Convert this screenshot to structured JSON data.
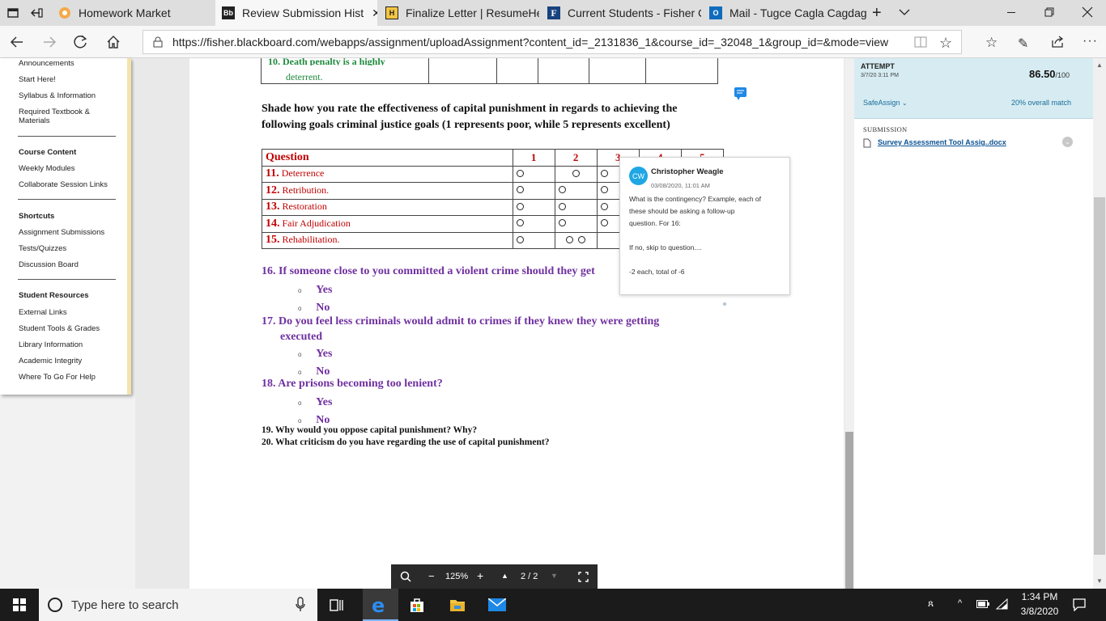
{
  "browser": {
    "tabs": [
      {
        "title": "Homework Market",
        "active": false
      },
      {
        "title": "Review Submission Hist",
        "active": true
      },
      {
        "title": "Finalize Letter | ResumeHelp",
        "active": false
      },
      {
        "title": "Current Students - Fisher Co",
        "active": false
      },
      {
        "title": "Mail - Tugce Cagla Cagdagu",
        "active": false
      }
    ],
    "url": "https://fisher.blackboard.com/webapps/assignment/uploadAssignment?content_id=_2131836_1&course_id=_32048_1&group_id=&mode=view"
  },
  "sidebar": {
    "top_items": [
      "Announcements",
      "Start Here!",
      "Syllabus & Information",
      "Required Textbook &",
      "Materials"
    ],
    "course_content": {
      "heading": "Course Content",
      "items": [
        "Weekly Modules",
        "Collaborate Session Links"
      ]
    },
    "shortcuts": {
      "heading": "Shortcuts",
      "items": [
        "Assignment Submissions",
        "Tests/Quizzes",
        "Discussion Board"
      ]
    },
    "student_resources": {
      "heading": "Student Resources",
      "items": [
        "External Links",
        "Student Tools & Grades",
        "Library Information",
        "Academic Integrity",
        "Where To Go For Help"
      ]
    }
  },
  "document": {
    "prev_row_line1": "10. Death penalty is a highly",
    "prev_row_line2": "deterrent.",
    "instruction_line1": "Shade how you rate the effectiveness of capital punishment in regards to achieving the",
    "instruction_line2": "following goals criminal justice goals (1 represents poor, while 5 represents excellent)",
    "table": {
      "header": [
        "Question",
        "1",
        "2",
        "3",
        "4",
        "5"
      ],
      "rows": [
        {
          "num": "11.",
          "label": "Deterrence"
        },
        {
          "num": "12.",
          "label": "Retribution."
        },
        {
          "num": "13.",
          "label": "Restoration"
        },
        {
          "num": "14.",
          "label": "Fair Adjudication"
        },
        {
          "num": "15.",
          "label": "Rehabilitation."
        }
      ]
    },
    "q16": "16. If someone close to you committed a violent crime should they get",
    "q17_line1": "17. Do you feel less criminals would admit to crimes if they knew they were getting",
    "q17_line2": "executed",
    "q18": "18. Are prisons becoming too lenient?",
    "yes": "Yes",
    "no": "No",
    "q19": "19.  Why would you oppose capital punishment? Why?",
    "q20": "20.  What criticism do you have regarding the use of capital punishment?"
  },
  "comment": {
    "initials": "CW",
    "author": "Christopher Weagle",
    "date": "03/08/2020, 11:01 AM",
    "line1": "What is the contingency? Example, each of",
    "line2": "these should be asking a follow-up",
    "line3": "question. For 16:",
    "line4": "If no, skip to question....",
    "line5": "-2 each, total of -6"
  },
  "viewer": {
    "zoom": "125%",
    "page": "2 / 2"
  },
  "panel": {
    "attempt_label": "ATTEMPT",
    "attempt_date": "3/7/20 3:11 PM",
    "score": "86.50",
    "score_max": "/100",
    "safeassign": "SafeAssign",
    "match": "20% overall match",
    "submission_label": "SUBMISSION",
    "file": "Survey Assessment Tool Assig..docx"
  },
  "taskbar": {
    "search_placeholder": "Type here to search",
    "time": "1:34 PM",
    "date": "3/8/2020"
  },
  "colors": {
    "question_red": "#c00000",
    "question_purple": "#7030a0",
    "panel_blue": "#d6ecf2",
    "link": "#0b5394"
  }
}
